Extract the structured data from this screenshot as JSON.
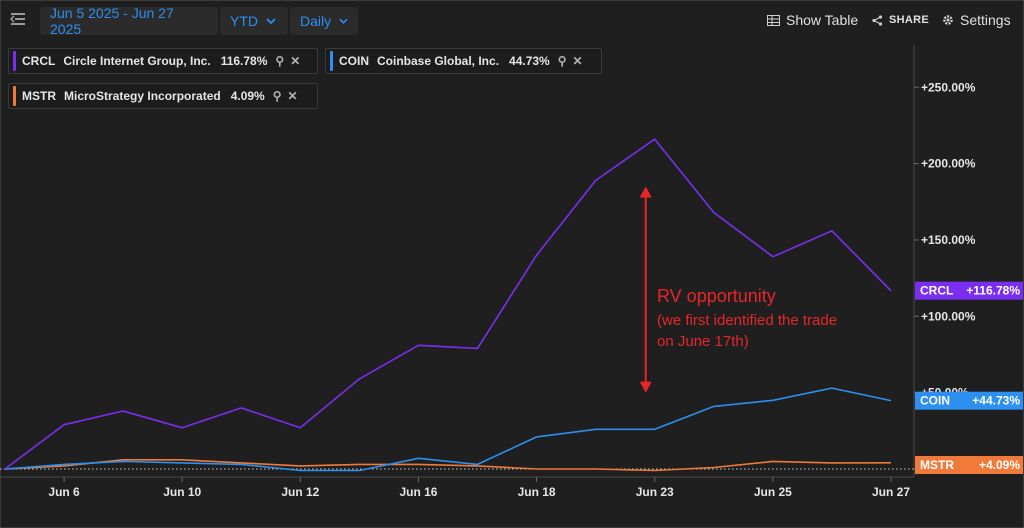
{
  "toolbar": {
    "date_range": "Jun 5 2025 - Jun 27 2025",
    "period": "YTD",
    "interval": "Daily",
    "show_table": "Show Table",
    "share": "SHARE",
    "settings": "Settings"
  },
  "legend": [
    {
      "symbol": "CRCL",
      "name": "Circle Internet Group, Inc.",
      "pct": "116.78%",
      "color": "#7a2ff0"
    },
    {
      "symbol": "COIN",
      "name": "Coinbase Global, Inc.",
      "pct": "44.73%",
      "color": "#2d8ff0"
    },
    {
      "symbol": "MSTR",
      "name": "MicroStrategy Incorporated",
      "pct": "4.09%",
      "color": "#f07a3a"
    }
  ],
  "annotation": {
    "title": "RV opportunity",
    "note": "(we first identified the trade on June 17th)",
    "color": "#e8262a"
  },
  "chart_data": {
    "type": "line",
    "x": [
      "Jun 5",
      "Jun 6",
      "Jun 9",
      "Jun 10",
      "Jun 11",
      "Jun 12",
      "Jun 13",
      "Jun 16",
      "Jun 17",
      "Jun 18",
      "Jun 20",
      "Jun 23",
      "Jun 24",
      "Jun 25",
      "Jun 26",
      "Jun 27"
    ],
    "x_tick_labels": [
      "Jun 6",
      "Jun 10",
      "Jun 12",
      "Jun 16",
      "Jun 18",
      "Jun 23",
      "Jun 25",
      "Jun 27"
    ],
    "y_tick_labels": [
      "+250.00%",
      "+200.00%",
      "+150.00%",
      "+100.00%",
      "+50.00%",
      "+0.00%"
    ],
    "ylim": [
      -5,
      275
    ],
    "series": [
      {
        "name": "CRCL",
        "color": "#7a2ff0",
        "end_label": "+116.78%",
        "values": [
          0,
          29,
          38,
          27,
          40,
          27,
          59,
          81,
          79,
          140,
          189,
          216,
          168,
          139,
          156,
          116.78
        ]
      },
      {
        "name": "COIN",
        "color": "#2d8ff0",
        "end_label": "+44.73%",
        "values": [
          0,
          3,
          5,
          4,
          3,
          -1,
          -1,
          7,
          3,
          21,
          26,
          26,
          41,
          45,
          53,
          44.73
        ]
      },
      {
        "name": "MSTR",
        "color": "#f07a3a",
        "end_label": "+4.09%",
        "values": [
          0,
          2,
          6,
          6,
          4,
          2,
          3,
          3,
          2,
          0,
          0,
          -1,
          1,
          5,
          4,
          4.09
        ]
      }
    ],
    "annotation_arrow": {
      "x": "Jun 23",
      "y_top": 185,
      "y_bottom": 50
    }
  }
}
